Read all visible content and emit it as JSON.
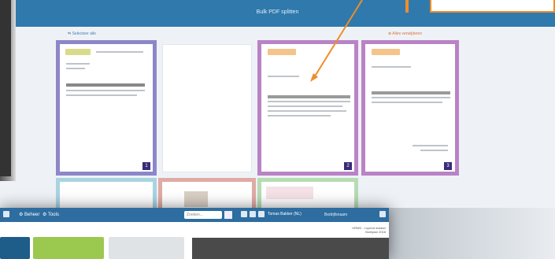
{
  "back_window": {
    "header_title": "Bulk PDF splitten",
    "link_left": "⇆ Selecteer alle",
    "link_right": "⊗ Alles verwijderen",
    "badges": [
      "1",
      "2",
      "3"
    ]
  },
  "front_window": {
    "nav": [
      "Beheer",
      "Tools"
    ],
    "search_placeholder": "Zoeken...",
    "user_info": "Tomas Bakker (NL)",
    "company": "Bedrijfsnaam",
    "right_lines": [
      "HRMS - Lopend dossier",
      "Boekjaar 2018"
    ]
  },
  "colors": {
    "header_blue": "#2f79ad",
    "accent_orange": "#f28c28",
    "purple_frame": "#b983c6",
    "violet_frame": "#8d86c9"
  }
}
